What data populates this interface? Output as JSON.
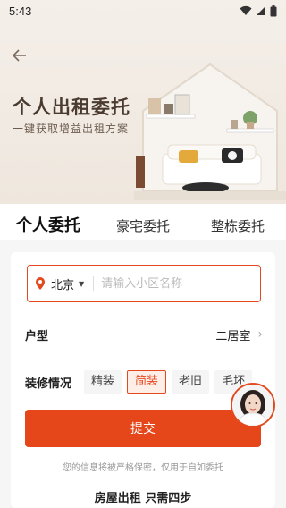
{
  "status_bar": {
    "time": "5:43"
  },
  "banner": {
    "title": "个人出租委托",
    "subtitle": "一键获取增益出租方案"
  },
  "tabs": [
    {
      "label": "个人委托",
      "active": true
    },
    {
      "label": "豪宅委托",
      "active": false
    },
    {
      "label": "整栋委托",
      "active": false
    }
  ],
  "form": {
    "city": "北京",
    "search_placeholder": "请输入小区名称",
    "room_type_label": "户型",
    "room_type_value": "二居室",
    "decoration_label": "装修情况",
    "decoration_options": [
      "精装",
      "简装",
      "老旧",
      "毛坯"
    ],
    "decoration_selected": "简装",
    "submit_label": "提交",
    "privacy_text": "您的信息将被严格保密，仅用于自如委托",
    "steps_title": "房屋出租 只需四步"
  },
  "colors": {
    "accent": "#e5461a",
    "banner_bg": "#f4efe9"
  }
}
